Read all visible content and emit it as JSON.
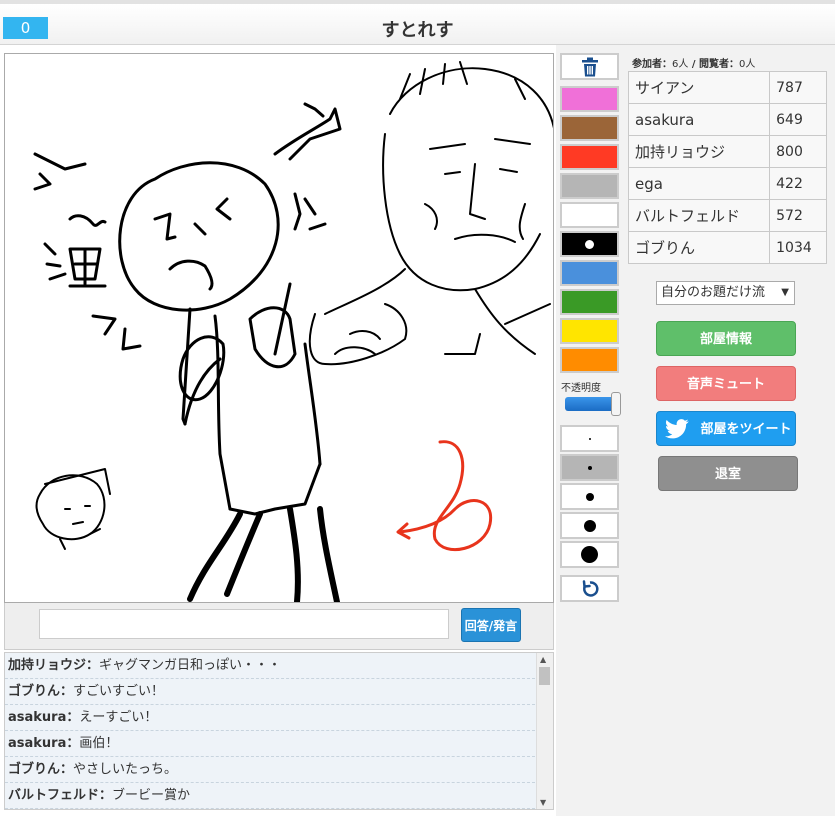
{
  "header": {
    "counter": "0",
    "title": "すとれす"
  },
  "answer": {
    "placeholder": "",
    "button_label": "回答/発言"
  },
  "chat": [
    {
      "user": "加持リョウジ",
      "msg": "ギャグマンガ日和っぽい・・・"
    },
    {
      "user": "ゴブりん",
      "msg": "すごいすごい！"
    },
    {
      "user": "asakura",
      "msg": "えーすごい！"
    },
    {
      "user": "asakura",
      "msg": "画伯！"
    },
    {
      "user": "ゴブりん",
      "msg": "やさしいたっち。"
    },
    {
      "user": "バルトフェルド",
      "msg": "ブービー賞か"
    }
  ],
  "tools": {
    "trash_icon": "trash-icon",
    "colors": [
      "#f070d8",
      "#9b6538",
      "#ff3a24",
      "#b5b5b5",
      "#ffffff",
      "#000000",
      "#4a90dc",
      "#3a9a26",
      "#ffe500",
      "#ff8c00"
    ],
    "opacity_label": "不透明度",
    "opacity": 0.95,
    "undo_icon": "undo-icon"
  },
  "participants": {
    "players_label": "参加者：",
    "players_value": "6人",
    "separator": " / ",
    "viewers_label": "閲覧者：",
    "viewers_value": "0人"
  },
  "scores": [
    {
      "name": "サイアン",
      "score": "787"
    },
    {
      "name": "asakura",
      "score": "649"
    },
    {
      "name": "加持リョウジ",
      "score": "800"
    },
    {
      "name": "ega",
      "score": "422"
    },
    {
      "name": "バルトフェルド",
      "score": "572"
    },
    {
      "name": "ゴブりん",
      "score": "1034"
    }
  ],
  "flow_select": {
    "value": "自分のお題だけ流"
  },
  "buttons": {
    "room_info": "部屋情報",
    "mute": "音声ミュート",
    "tweet": "部屋をツイート",
    "exit": "退室"
  },
  "colors": {
    "accent": "#33b5f0",
    "room": "#5fbf6a",
    "mute": "#f27d7d",
    "tweet": "#1f9ef0",
    "exit": "#8f8f8f"
  }
}
